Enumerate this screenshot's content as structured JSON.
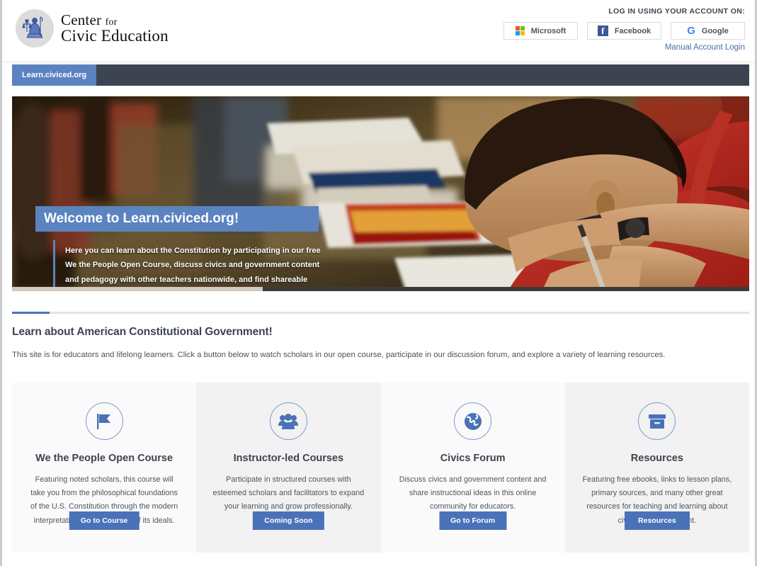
{
  "header": {
    "brand": {
      "line1_main": "Center",
      "line1_small": "for",
      "line2": "Civic Education",
      "seal_icon": "lady-justice-seal-icon"
    },
    "login_label": "LOG IN USING YOUR ACCOUNT ON:",
    "providers": [
      {
        "name": "Microsoft",
        "icon": "microsoft-logo-icon"
      },
      {
        "name": "Facebook",
        "icon": "facebook-logo-icon"
      },
      {
        "name": "Google",
        "icon": "google-logo-icon"
      }
    ],
    "manual_login": "Manual Account Login"
  },
  "navbar": {
    "tab_label": "Learn.civiced.org",
    "tab_color": "#5b83c0",
    "bar_color": "#3c4451"
  },
  "hero": {
    "title": "Welcome to Learn.civiced.org!",
    "body": "Here you can learn about the Constitution by participating in our free We the People Open Course, discuss civics and government content and pedagogy with other teachers nationwide, and find shareable content in our Resources section.",
    "progress_percent": 34,
    "title_bg": "#5b83c0"
  },
  "section": {
    "title": "Learn about American Constitutional Government!",
    "subtitle": "This site is for educators and lifelong learners. Click a button below to watch scholars in our open course, participate in our discussion forum, and explore a variety of learning resources.",
    "accent_color": "#4a72b8"
  },
  "cards": [
    {
      "icon": "flag-icon",
      "title": "We the People Open Course",
      "text": "Featuring noted scholars, this course will take you from the philosophical foundations of the U.S. Constitution through the modern interpretation and application of its ideals.",
      "button": "Go to Course"
    },
    {
      "icon": "users-group-icon",
      "title": "Instructor-led Courses",
      "text": "Participate in structured courses with esteemed scholars and facilitators to expand your learning and grow professionally.",
      "button": "Coming Soon"
    },
    {
      "icon": "globe-icon",
      "title": "Civics Forum",
      "text": "Discuss civics and government content and share instructional ideas in this online community for educators.",
      "button": "Go to Forum"
    },
    {
      "icon": "archive-box-icon",
      "title": "Resources",
      "text": "Featuring free ebooks, links to lesson plans, primary sources, and many other great resources for teaching and learning about civics and government.",
      "button": "Resources"
    }
  ]
}
